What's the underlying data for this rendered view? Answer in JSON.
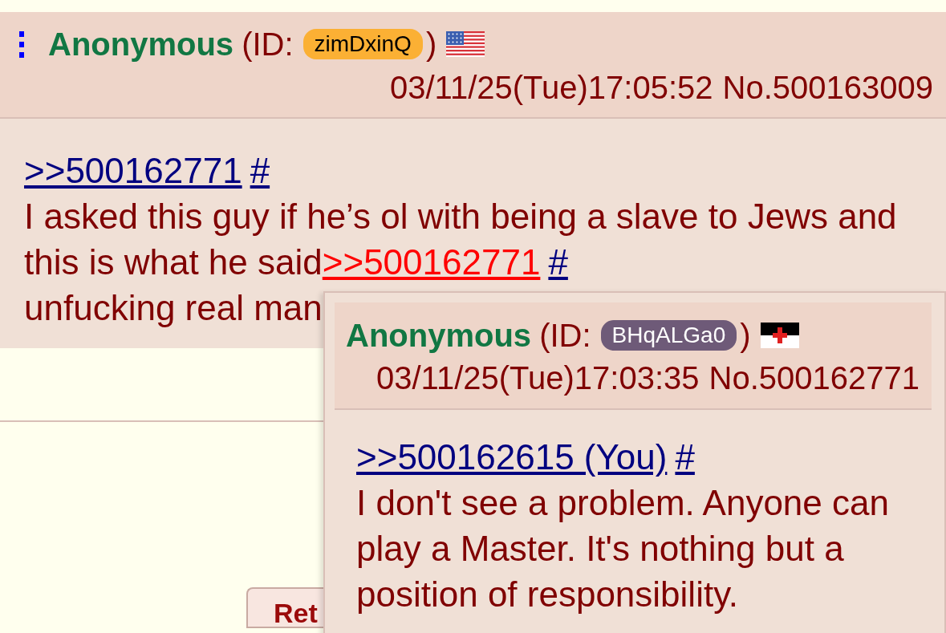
{
  "post": {
    "name": "Anonymous",
    "id_open": "(ID:",
    "id": {
      "text": "zimDxinQ",
      "color": "#fbb034"
    },
    "id_close": ")",
    "flag": {
      "kind": "us"
    },
    "datetime": "03/11/25(Tue)17:05:52",
    "number": "No.500163009",
    "body": [
      [
        {
          "kind": "quote",
          "text": ">>500162771"
        },
        {
          "kind": "hash",
          "text": "#"
        }
      ],
      [
        {
          "kind": "text",
          "text": "I asked this guy if he’s ol with being a slave to Jews and this is what he said"
        },
        {
          "kind": "hover_quote",
          "text": ">>500162771"
        },
        {
          "kind": "hash",
          "text": "#"
        }
      ],
      [
        {
          "kind": "text",
          "text": "unfucking real man"
        }
      ]
    ]
  },
  "return_button": {
    "label": "Ret"
  },
  "preview": {
    "name": "Anonymous",
    "id_open": "(ID:",
    "id": {
      "text": "BHqALGa0",
      "color": "#6e5a78"
    },
    "id_close": ")",
    "flag": {
      "kind": "templar"
    },
    "datetime": "03/11/25(Tue)17:03:35",
    "number": "No.500162771",
    "body": [
      [
        {
          "kind": "quote",
          "text": ">>500162615 (You)"
        },
        {
          "kind": "hash",
          "text": "#"
        }
      ],
      [
        {
          "kind": "text",
          "text": "I don't see a problem. Anyone can play a Master. It's nothing but a position of responsibility."
        }
      ]
    ]
  }
}
